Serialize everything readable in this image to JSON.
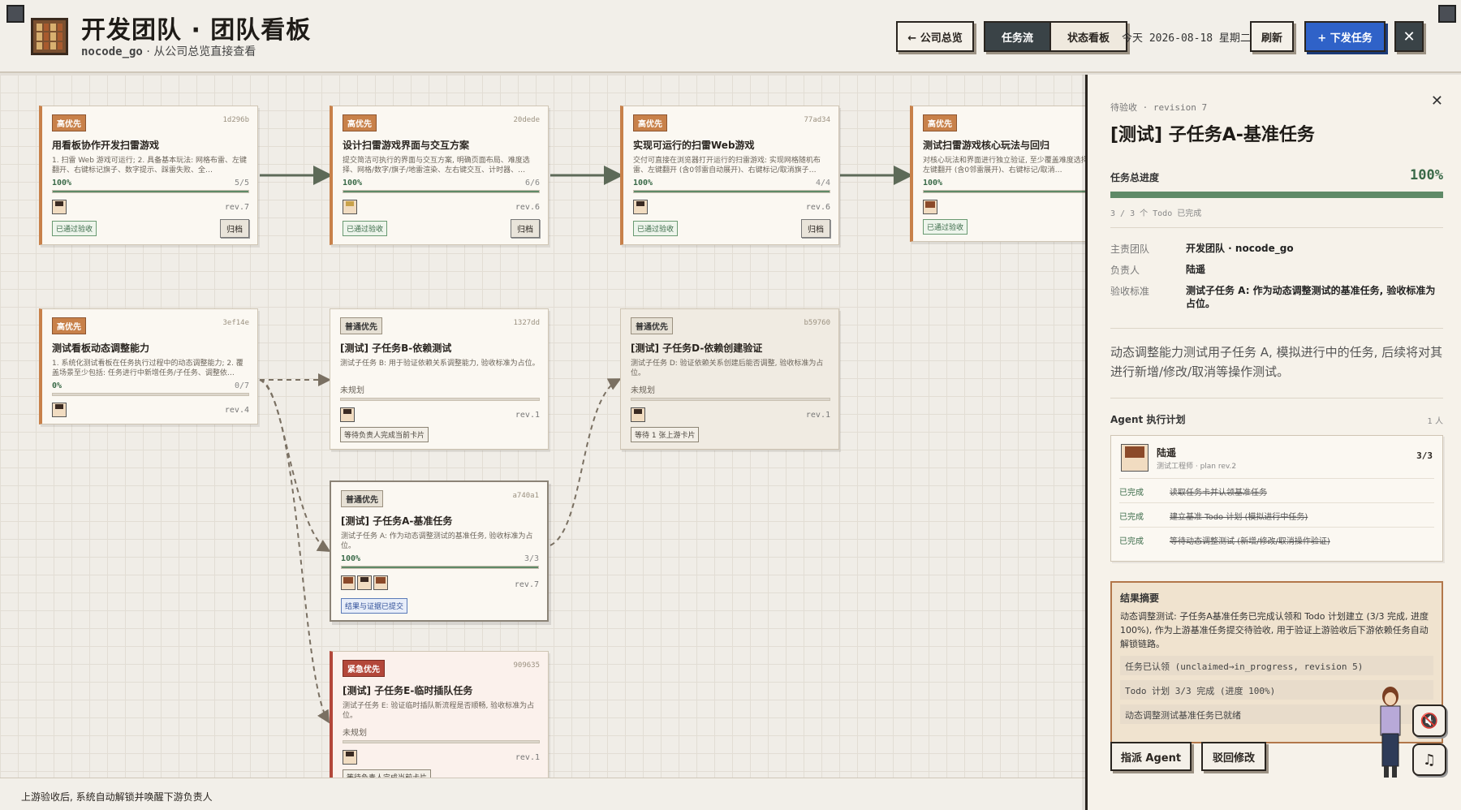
{
  "header": {
    "title": "开发团队 · 团队看板",
    "team_code": "nocode_go",
    "subtitle_suffix": "· 从公司总览直接查看",
    "back_label": "← 公司总览",
    "tab_flow": "任务流",
    "tab_status": "状态看板",
    "today_label": "今天 2026-08-18 星期二",
    "refresh_label": "刷新",
    "dispatch_label": "+ 下发任务",
    "close_label": "✕"
  },
  "cards": [
    {
      "prio": "高优先",
      "hash": "1d296b",
      "title": "用看板协作开发扫雷游戏",
      "desc": "1. 扫雷 Web 游戏可运行; 2. 具备基本玩法: 网格布雷、左键翻开、右键标记旗子、数字提示、踩雷失败、全…",
      "pct": "100%",
      "count": "5/5",
      "rev": "rev.7",
      "tag": "已通过验收",
      "archive": "归档"
    },
    {
      "prio": "高优先",
      "hash": "20dede",
      "title": "设计扫雷游戏界面与交互方案",
      "desc": "提交简洁可执行的界面与交互方案, 明确页面布局、难度选择、网格/数字/旗子/地雷渲染、左右键交互、计时器、…",
      "pct": "100%",
      "count": "6/6",
      "rev": "rev.6",
      "tag": "已通过验收",
      "archive": "归档"
    },
    {
      "prio": "高优先",
      "hash": "77ad34",
      "title": "实现可运行的扫雷Web游戏",
      "desc": "交付可直接在浏览器打开运行的扫雷游戏: 实现网格随机布雷、左键翻开 (含0邻雷自动展开)、右键标记/取消旗子…",
      "pct": "100%",
      "count": "4/4",
      "rev": "rev.6",
      "tag": "已通过验收",
      "archive": "归档"
    },
    {
      "prio": "高优先",
      "hash": "",
      "title": "测试扫雷游戏核心玩法与回归",
      "desc": "对核心玩法和界面进行独立验证, 至少覆盖难度选择、渲染、左键翻开 (含0邻雷展开)、右键标记/取消…",
      "pct": "100%",
      "count": "",
      "rev": "",
      "tag": "已通过验收",
      "archive": ""
    },
    {
      "prio": "高优先",
      "hash": "3ef14e",
      "title": "测试看板动态调整能力",
      "desc": "1. 系统化测试看板在任务执行过程中的动态调整能力; 2. 覆盖场景至少包括: 任务进行中新增任务/子任务、调整依…",
      "pct": "0%",
      "count": "0/7",
      "rev": "rev.4"
    },
    {
      "prio": "普通优先",
      "hash": "1327dd",
      "title": "[测试] 子任务B-依赖测试",
      "desc": "测试子任务 B: 用于验证依赖关系调整能力, 验收标准为占位。",
      "status": "未规划",
      "rev": "rev.1",
      "tag": "等待负责人完成当前卡片"
    },
    {
      "prio": "普通优先",
      "hash": "b59760",
      "title": "[测试] 子任务D-依赖创建验证",
      "desc": "测试子任务 D: 验证依赖关系创建后能否调整, 验收标准为占位。",
      "status": "未规划",
      "rev": "rev.1",
      "tag": "等待 1 张上游卡片"
    },
    {
      "prio": "普通优先",
      "hash": "a740a1",
      "title": "[测试] 子任务A-基准任务",
      "desc": "测试子任务 A: 作为动态调整测试的基准任务, 验收标准为占位。",
      "pct": "100%",
      "count": "3/3",
      "rev": "rev.7",
      "tag": "结果与证据已提交"
    },
    {
      "prio": "紧急优先",
      "hash": "909635",
      "title": "[测试] 子任务E-临时插队任务",
      "desc": "测试子任务 E: 验证临时插队新流程是否顺畅, 验收标准为占位。",
      "status": "未规划",
      "rev": "rev.1",
      "tag": "等待负责人完成当前卡片"
    }
  ],
  "statusbar": {
    "text": "上游验收后, 系统自动解锁并唤醒下游负责人"
  },
  "panel": {
    "meta": "待验收 · revision 7",
    "title": "[测试] 子任务A-基准任务",
    "close": "✕",
    "progress_label": "任务总进度",
    "progress_value": "100%",
    "progress_fraction": 1.0,
    "progress_note": "3 / 3 个 Todo 已完成",
    "team_key": "主责团队",
    "team_value": "开发团队 · nocode_go",
    "owner_key": "负责人",
    "owner_value": "陆遥",
    "criteria_key": "验收标准",
    "criteria_value": "测试子任务 A: 作为动态调整测试的基准任务, 验收标准为占位。",
    "description": "动态调整能力测试用子任务 A, 模拟进行中的任务, 后续将对其进行新增/修改/取消等操作测试。",
    "agent_section": "Agent 执行计划",
    "agent_count": "1 人",
    "agent_name": "陆遥",
    "agent_role": "测试工程师 · plan rev.2",
    "agent_progress": "3/3",
    "todos": [
      {
        "status": "已完成",
        "text": "读取任务卡并认领基准任务"
      },
      {
        "status": "已完成",
        "text": "建立基准 Todo 计划 (模拟进行中任务)"
      },
      {
        "status": "已完成",
        "text": "等待动态调整测试 (新增/修改/取消操作验证)"
      }
    ],
    "summary_title": "结果摘要",
    "summary_text": "动态调整测试: 子任务A基准任务已完成认领和 Todo 计划建立 (3/3 完成, 进度 100%), 作为上游基准任务提交待验收, 用于验证上游验收后下游依赖任务自动解锁链路。",
    "summary_lines": [
      "任务已认领 (unclaimed→in_progress, revision 5)",
      "Todo 计划 3/3 完成 (进度 100%)",
      "动态调整测试基准任务已就绪"
    ],
    "btn_assign": "指派 Agent",
    "btn_reject": "驳回修改",
    "mute_icon": "🔇",
    "music_icon": "♫"
  },
  "colors": {
    "accent": "#2f62c8",
    "high": "#c8814a",
    "urgent": "#b3473a",
    "done": "#5f8a67"
  }
}
